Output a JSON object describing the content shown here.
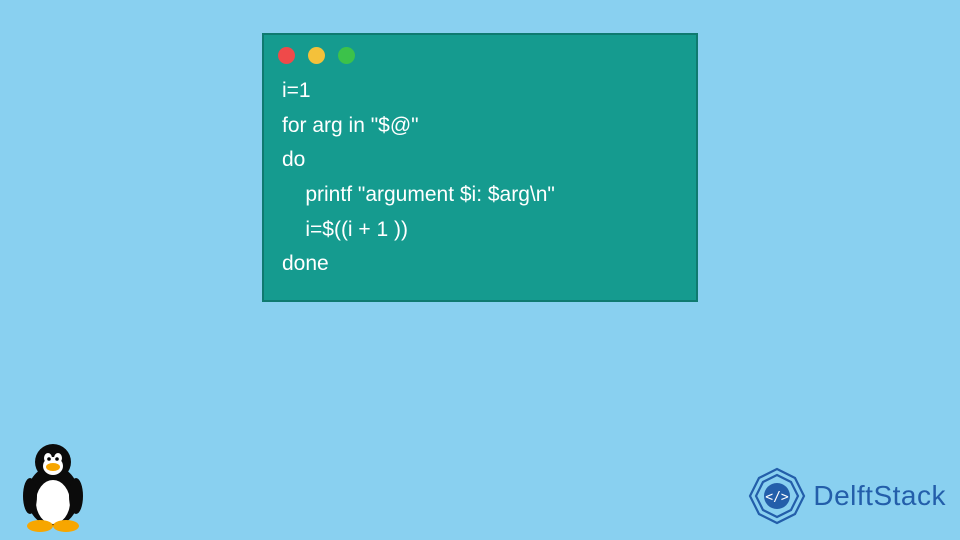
{
  "code": {
    "lines": [
      "i=1",
      "for arg in \"$@\"",
      "do",
      "    printf \"argument $i: $arg\\n\"",
      "    i=$((i + 1 ))",
      "done"
    ]
  },
  "window": {
    "dots": [
      "red",
      "yellow",
      "green"
    ]
  },
  "branding": {
    "name": "DelftStack"
  },
  "colors": {
    "background": "#89d0f0",
    "window": "#159b8f",
    "brand": "#235eaa"
  }
}
